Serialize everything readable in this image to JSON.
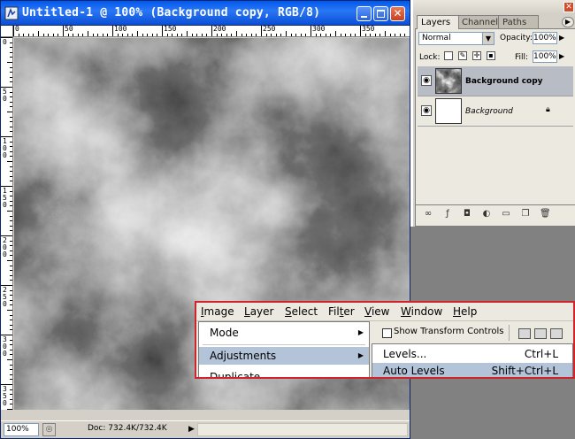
{
  "document": {
    "title": "Untitled-1 @ 100% (Background copy, RGB/8)",
    "zoom": "100%",
    "doc_info": "Doc: 732.4K/732.4K",
    "ruler_top_labels": [
      "0",
      "50",
      "100",
      "150",
      "200",
      "250",
      "300",
      "350",
      "400"
    ],
    "ruler_left_labels": [
      "0",
      "5\n0",
      "1\n0\n0",
      "1\n5\n0",
      "2\n0\n0",
      "2\n5\n0",
      "3\n0\n0",
      "3\n5\n0",
      "4\n0\n0"
    ]
  },
  "layers_panel": {
    "tabs": [
      "Layers",
      "Channels",
      "Paths"
    ],
    "blend_mode": "Normal",
    "opacity_label": "Opacity:",
    "opacity_value": "100%",
    "lock_label": "Lock:",
    "fill_label": "Fill:",
    "fill_value": "100%",
    "layers": [
      {
        "name": "Background copy",
        "selected": true,
        "visible": true
      },
      {
        "name": "Background",
        "selected": false,
        "visible": true,
        "locked": true
      }
    ]
  },
  "menubar": {
    "items": [
      {
        "mnemonic": "I",
        "rest": "mage"
      },
      {
        "mnemonic": "L",
        "rest": "ayer",
        "pre": ""
      },
      {
        "mnemonic": "S",
        "rest": "elect"
      },
      {
        "pre": "Fil",
        "mnemonic": "t",
        "rest": "er"
      },
      {
        "mnemonic": "V",
        "rest": "iew"
      },
      {
        "mnemonic": "W",
        "rest": "indow"
      },
      {
        "mnemonic": "H",
        "rest": "elp"
      }
    ]
  },
  "image_menu": {
    "mode": "Mode",
    "adjustments": "Adjustments",
    "duplicate": "Duplicate..."
  },
  "options_bar": {
    "show_transform_controls": "Show Transform Controls"
  },
  "adjustments_submenu": {
    "levels": "Levels...",
    "levels_shortcut": "Ctrl+L",
    "auto_levels": "Auto Levels",
    "auto_levels_shortcut": "Shift+Ctrl+L"
  },
  "colors": {
    "titlebar": "#0058ee",
    "selection_highlight": "#b3c3d8",
    "overlay_border": "#d0242a"
  }
}
